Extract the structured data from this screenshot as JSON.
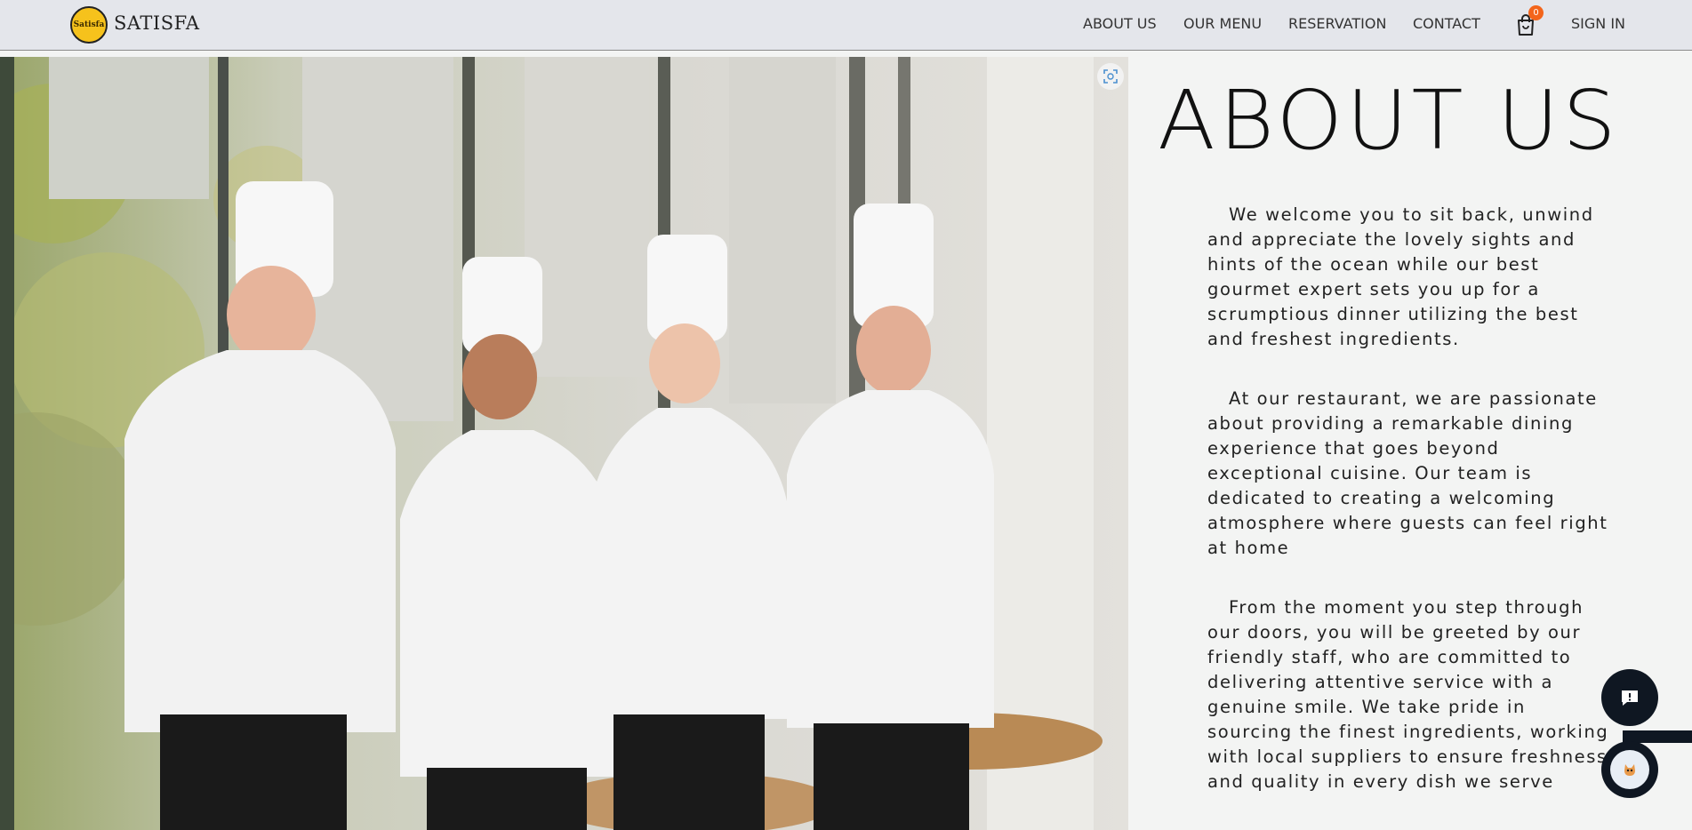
{
  "header": {
    "logo_text": "Satisfa",
    "brand": "SATISFA",
    "nav": {
      "about": "ABOUT US",
      "menu": "OUR MENU",
      "reservation": "RESERVATION",
      "contact": "CONTACT",
      "sign_in": "SIGN IN"
    },
    "cart_count": "0",
    "cart_icon": "shopping-bag-icon"
  },
  "photo": {
    "zoom_icon": "expand-scan-icon"
  },
  "about": {
    "title": "ABOUT US",
    "paragraphs": [
      "We welcome you to sit back, unwind and appreciate the lovely sights and hints of the ocean while our best gourmet expert sets you up for a scrumptious dinner utilizing the best and freshest ingredients.",
      "At our restaurant, we are passionate about providing a remarkable dining experience that goes beyond exceptional cuisine. Our team is dedicated to creating a welcoming atmosphere where guests can feel right at home",
      "From the moment you step through our doors, you will be greeted by our friendly staff, who are committed to delivering attentive service with a genuine smile. We take pride in sourcing the finest ingredients, working with local suppliers to ensure freshness and quality in every dish we serve"
    ]
  },
  "floating": {
    "feedback_icon": "feedback-chat-icon",
    "assistant_icon": "assistant-avatar-icon"
  },
  "colors": {
    "header_bg": "#e4e6eb",
    "badge": "#f3651b",
    "float_bg": "#0f1722",
    "logo": "#f6c21c"
  }
}
